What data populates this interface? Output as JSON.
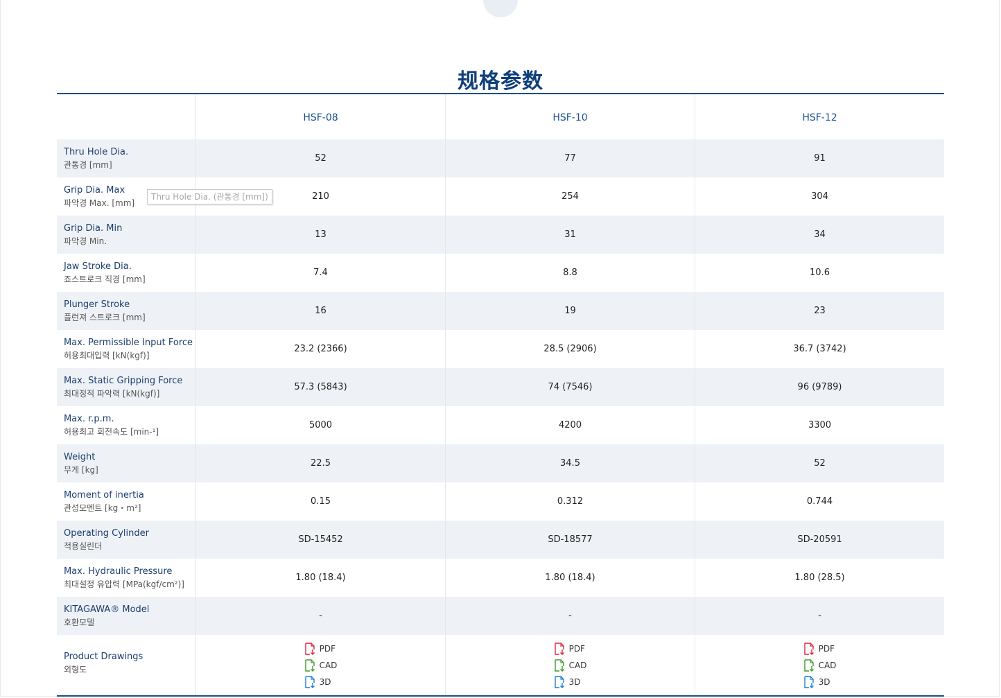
{
  "page": {
    "title": "规格参数"
  },
  "table": {
    "columns": [
      "HSF-08",
      "HSF-10",
      "HSF-12"
    ],
    "rows": [
      {
        "en": "Thru Hole Dia.",
        "ko": "관통경 [mm]",
        "values": [
          "52",
          "77",
          "91"
        ]
      },
      {
        "en": "Grip Dia. Max",
        "ko": "파악경 Max. [mm]",
        "values": [
          "210",
          "254",
          "304"
        ]
      },
      {
        "en": "Grip Dia. Min",
        "ko": "파악경 Min.",
        "values": [
          "13",
          "31",
          "34"
        ]
      },
      {
        "en": "Jaw Stroke Dia.",
        "ko": "죠스트로크 직경 [mm]",
        "values": [
          "7.4",
          "8.8",
          "10.6"
        ]
      },
      {
        "en": "Plunger Stroke",
        "ko": "플런져 스트로크 [mm]",
        "values": [
          "16",
          "19",
          "23"
        ]
      },
      {
        "en": "Max. Permissible Input Force",
        "ko": "허용최대입력 [kN(kgf)]",
        "values": [
          "23.2 (2366)",
          "28.5 (2906)",
          "36.7 (3742)"
        ]
      },
      {
        "en": "Max. Static Gripping Force",
        "ko": "최대정적 파악력 [kN(kgf)]",
        "values": [
          "57.3 (5843)",
          "74 (7546)",
          "96 (9789)"
        ]
      },
      {
        "en": "Max. r.p.m.",
        "ko": "허용최고 회전속도 [min-¹]",
        "values": [
          "5000",
          "4200",
          "3300"
        ]
      },
      {
        "en": "Weight",
        "ko": "무게 [kg]",
        "values": [
          "22.5",
          "34.5",
          "52"
        ]
      },
      {
        "en": "Moment of inertia",
        "ko": "관성모멘트 [kg・m²]",
        "values": [
          "0.15",
          "0.312",
          "0.744"
        ]
      },
      {
        "en": "Operating Cylinder",
        "ko": "적용실린더",
        "values": [
          "SD-15452",
          "SD-18577",
          "SD-20591"
        ]
      },
      {
        "en": "Max. Hydraulic Pressure",
        "ko": "최대설정 유압력 [MPa(kgf/cm²)]",
        "values": [
          "1.80 (18.4)",
          "1.80 (18.4)",
          "1.80 (28.5)"
        ]
      },
      {
        "en": "KITAGAWA® Model",
        "ko": "호환모델",
        "values": [
          "-",
          "-",
          "-"
        ]
      }
    ],
    "drawings": {
      "en": "Product Drawings",
      "ko": "외형도",
      "links": [
        {
          "label": "PDF",
          "icon": "pdf-file-icon",
          "color": "#d9263c"
        },
        {
          "label": "CAD",
          "icon": "cad-file-icon",
          "color": "#3a9b2b"
        },
        {
          "label": "3D",
          "icon": "3d-file-icon",
          "color": "#1f7fd1"
        }
      ]
    }
  },
  "tooltip": {
    "text": "Thru Hole Dia. (관통경 [mm])"
  }
}
